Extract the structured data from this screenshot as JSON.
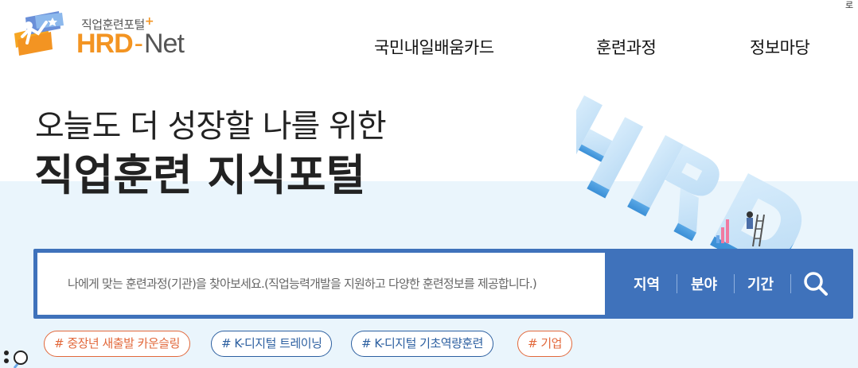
{
  "header": {
    "logo_sub": "직업훈련포털",
    "logo_plus": "+",
    "logo_hrd": "HRD",
    "logo_dash": "-",
    "logo_net": "Net",
    "corner_text": "로",
    "nav": [
      {
        "label": "국민내일배움카드"
      },
      {
        "label": "훈련과정"
      },
      {
        "label": "정보마당"
      }
    ]
  },
  "hero": {
    "line1": "오늘도 더 성장할 나를 위한",
    "line2": "직업훈련 지식포털"
  },
  "search": {
    "placeholder": "나에게 맞는 훈련과정(기관)을 찾아보세요.(직업능력개발을 지원하고 다양한 훈련정보를 제공합니다.)",
    "filters": [
      {
        "label": "지역"
      },
      {
        "label": "분야"
      },
      {
        "label": "기간"
      }
    ],
    "button_icon": "search-icon"
  },
  "tags": [
    {
      "label": "# 중장년 새출발 카운슬링",
      "color": "#e2683b"
    },
    {
      "label": "# K-디지털 트레이닝",
      "color": "#2c5fa0"
    },
    {
      "label": "# K-디지털 기초역량훈련",
      "color": "#2c5fa0"
    },
    {
      "label": "# 기업",
      "color": "#e2683b"
    }
  ],
  "colors": {
    "accent_blue": "#3f72bb",
    "brand_orange": "#f39422",
    "band_bg": "#eaf5fc"
  }
}
